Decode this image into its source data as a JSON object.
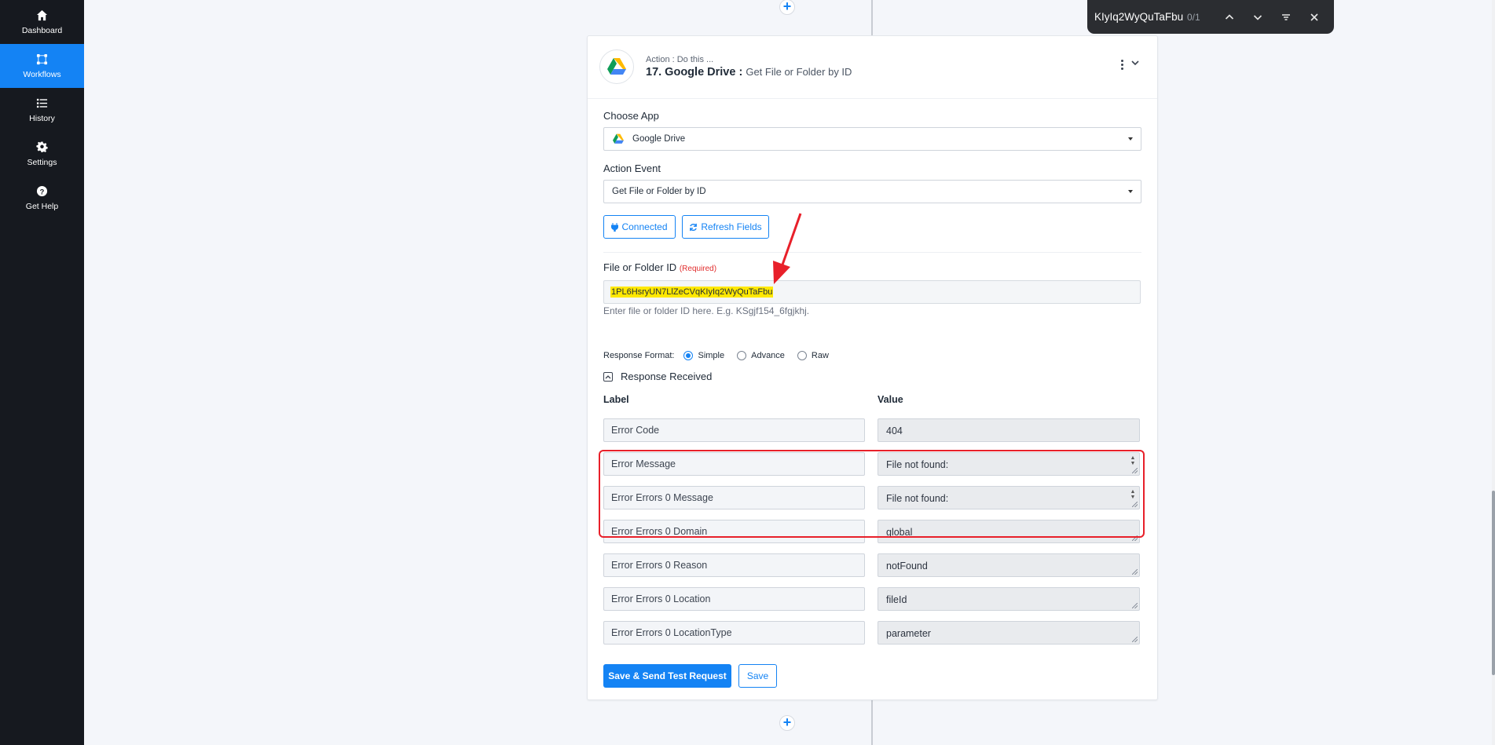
{
  "sidebar": {
    "items": [
      {
        "label": "Dashboard",
        "icon": "home-icon"
      },
      {
        "label": "Workflows",
        "icon": "workflow-icon"
      },
      {
        "label": "History",
        "icon": "list-icon"
      },
      {
        "label": "Settings",
        "icon": "gear-icon"
      },
      {
        "label": "Get Help",
        "icon": "help-icon"
      }
    ],
    "active": "Workflows"
  },
  "action": {
    "subtitle": "Action : Do this ...",
    "title": "17. Google Drive :",
    "event_name": "Get File or Folder by ID"
  },
  "choose_app": {
    "label": "Choose App",
    "value": "Google Drive"
  },
  "action_event": {
    "label": "Action Event",
    "value": "Get File or Folder by ID"
  },
  "buttons": {
    "connected": "Connected",
    "refresh": "Refresh Fields",
    "save_send": "Save & Send Test Request",
    "save": "Save"
  },
  "file_id": {
    "label": "File or Folder ID",
    "required": "(Required)",
    "value": "1PL6HsryUN7LlZeCVqKIyIq2WyQuTaFbu",
    "help": "Enter file or folder ID here. E.g. KSgjf154_6fgjkhj."
  },
  "response_format": {
    "label": "Response Format:",
    "options": [
      "Simple",
      "Advance",
      "Raw"
    ],
    "selected": "Simple"
  },
  "response": {
    "toggle_label": "Response Received",
    "col_label": "Label",
    "col_value": "Value",
    "rows": [
      {
        "label": "Error Code",
        "value": "404"
      },
      {
        "label": "Error Message",
        "value": "File not found:"
      },
      {
        "label": "Error Errors 0 Message",
        "value": "File not found:"
      },
      {
        "label": "Error Errors 0 Domain",
        "value": "global"
      },
      {
        "label": "Error Errors 0 Reason",
        "value": "notFound"
      },
      {
        "label": "Error Errors 0 Location",
        "value": "fileId"
      },
      {
        "label": "Error Errors 0 LocationType",
        "value": "parameter"
      }
    ]
  },
  "findbar": {
    "query": "KIyIq2WyQuTaFbu",
    "count": "0/1"
  },
  "colors": {
    "accent": "#1483f4",
    "sidebar_bg": "#16191f",
    "highlight": "#ffe800",
    "annotation": "#e8202a"
  }
}
